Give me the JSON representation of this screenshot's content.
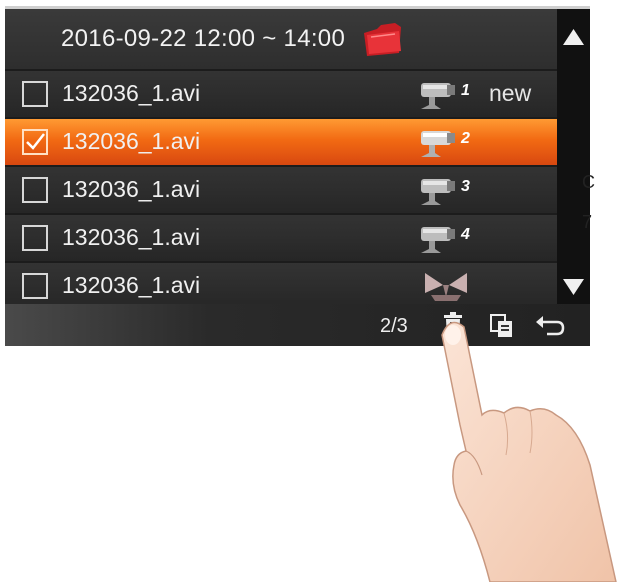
{
  "header": {
    "date_range": "2016-09-22  12:00 ~ 14:00"
  },
  "files": [
    {
      "name": "132036_1.avi",
      "camera": "1",
      "checked": false,
      "selected": false,
      "badge": "new"
    },
    {
      "name": "132036_1.avi",
      "camera": "2",
      "checked": true,
      "selected": true,
      "badge": ""
    },
    {
      "name": "132036_1.avi",
      "camera": "3",
      "checked": false,
      "selected": false,
      "badge": ""
    },
    {
      "name": "132036_1.avi",
      "camera": "4",
      "checked": false,
      "selected": false,
      "badge": ""
    },
    {
      "name": "132036_1.avi",
      "camera": "",
      "checked": false,
      "selected": false,
      "badge": ""
    }
  ],
  "footer": {
    "page": "2/3"
  },
  "stray_text": [
    "C",
    "7"
  ],
  "icons": {
    "folder": "folder-icon",
    "camera": "camera-icon",
    "trash": "trash-icon",
    "copy": "copy-icon",
    "back": "back-arrow-icon",
    "up": "scroll-up-icon",
    "down": "scroll-down-icon"
  },
  "colors": {
    "selected_row": "#f26a13",
    "folder": "#d8262a",
    "camera_number": "#ffffff"
  }
}
